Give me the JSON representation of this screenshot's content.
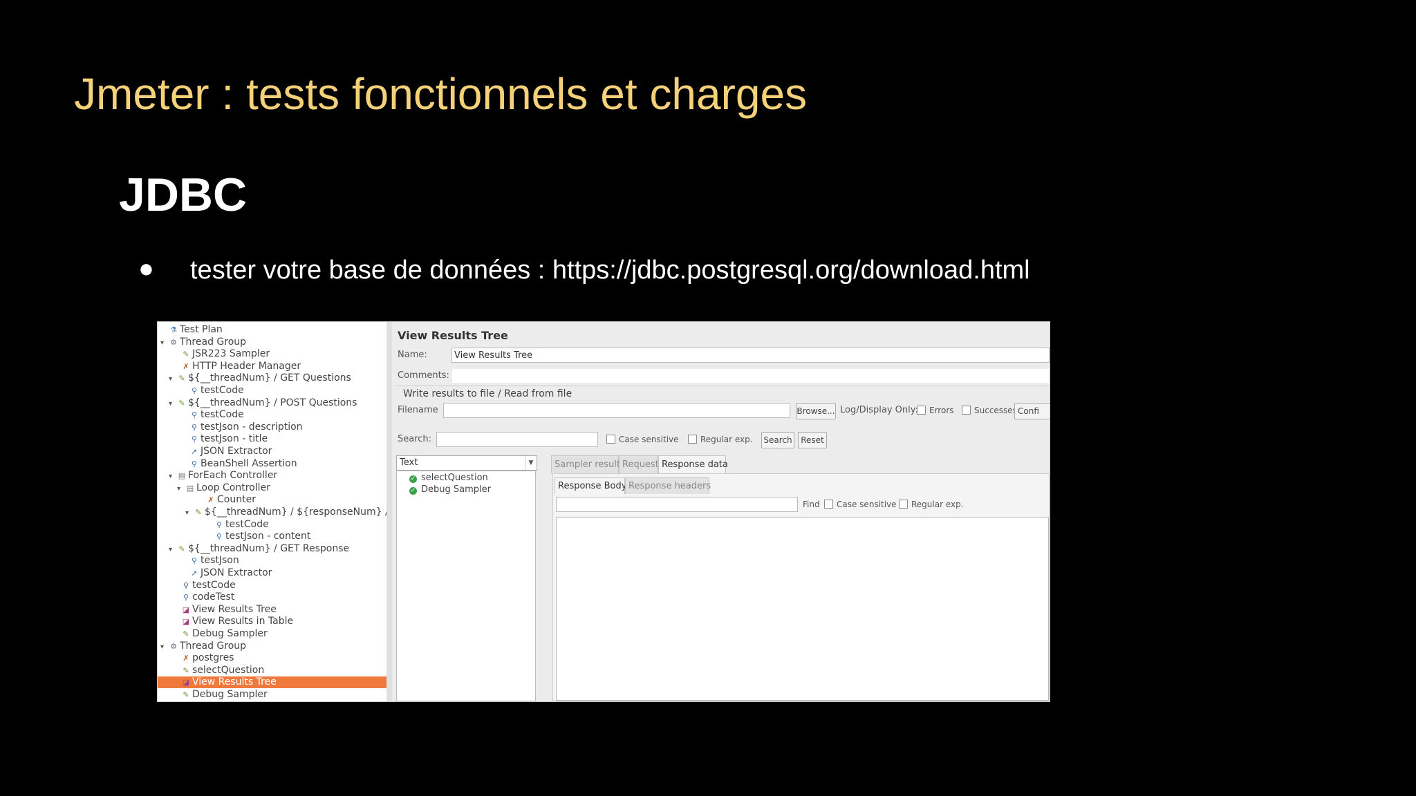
{
  "slide": {
    "title": "Jmeter : tests fonctionnels et charges",
    "subtitle": "JDBC",
    "bullet": "●",
    "bullet_text": "tester votre base de données : https://jdbc.postgresql.org/download.html"
  },
  "tree": {
    "items": [
      {
        "label": "Test Plan",
        "exp": "",
        "icon": "test-plan-icon",
        "glyph": "⚗"
      },
      {
        "label": "Thread Group",
        "exp": "▾",
        "icon": "thread-group-icon",
        "glyph": "⚙"
      },
      {
        "label": "JSR223 Sampler",
        "exp": "",
        "icon": "sampler-icon",
        "glyph": "✎"
      },
      {
        "label": "HTTP Header Manager",
        "exp": "",
        "icon": "config-icon",
        "glyph": "✗"
      },
      {
        "label": "${__threadNum} / GET Questions",
        "exp": "▾",
        "icon": "sampler-icon",
        "glyph": "✎"
      },
      {
        "label": "testCode",
        "exp": "",
        "icon": "assertion-icon",
        "glyph": "⚲"
      },
      {
        "label": "${__threadNum} / POST Questions",
        "exp": "▾",
        "icon": "sampler-icon",
        "glyph": "✎"
      },
      {
        "label": "testCode",
        "exp": "",
        "icon": "assertion-icon",
        "glyph": "⚲"
      },
      {
        "label": "testJson - description",
        "exp": "",
        "icon": "assertion-icon",
        "glyph": "⚲"
      },
      {
        "label": "testJson - title",
        "exp": "",
        "icon": "assertion-icon",
        "glyph": "⚲"
      },
      {
        "label": "JSON Extractor",
        "exp": "",
        "icon": "extractor-icon",
        "glyph": "➚"
      },
      {
        "label": "BeanShell Assertion",
        "exp": "",
        "icon": "assertion-icon",
        "glyph": "⚲"
      },
      {
        "label": "ForEach Controller",
        "exp": "▾",
        "icon": "controller-icon",
        "glyph": "▤"
      },
      {
        "label": "Loop Controller",
        "exp": "▾",
        "icon": "controller-icon",
        "glyph": "▤"
      },
      {
        "label": "Counter",
        "exp": "",
        "icon": "config-icon",
        "glyph": "✗"
      },
      {
        "label": "${__threadNum} / ${responseNum} / P",
        "exp": "▾",
        "icon": "sampler-icon",
        "glyph": "✎"
      },
      {
        "label": "testCode",
        "exp": "",
        "icon": "assertion-icon",
        "glyph": "⚲"
      },
      {
        "label": "testJson - content",
        "exp": "",
        "icon": "assertion-icon",
        "glyph": "⚲"
      },
      {
        "label": "${__threadNum} / GET Response",
        "exp": "▾",
        "icon": "sampler-icon",
        "glyph": "✎"
      },
      {
        "label": "testJson",
        "exp": "",
        "icon": "assertion-icon",
        "glyph": "⚲"
      },
      {
        "label": "JSON Extractor",
        "exp": "",
        "icon": "extractor-icon",
        "glyph": "➚"
      },
      {
        "label": "testCode",
        "exp": "",
        "icon": "assertion-icon",
        "glyph": "⚲"
      },
      {
        "label": "codeTest",
        "exp": "",
        "icon": "assertion-icon",
        "glyph": "⚲"
      },
      {
        "label": "View Results Tree",
        "exp": "",
        "icon": "listener-icon",
        "glyph": "◪"
      },
      {
        "label": "View Results in Table",
        "exp": "",
        "icon": "listener-icon",
        "glyph": "◪"
      },
      {
        "label": "Debug Sampler",
        "exp": "",
        "icon": "sampler-icon",
        "glyph": "✎"
      },
      {
        "label": "Thread Group",
        "exp": "▾",
        "icon": "thread-group-icon",
        "glyph": "⚙"
      },
      {
        "label": "postgres",
        "exp": "",
        "icon": "config-icon",
        "glyph": "✗"
      },
      {
        "label": "selectQuestion",
        "exp": "",
        "icon": "sampler-icon",
        "glyph": "✎"
      },
      {
        "label": "View Results Tree",
        "exp": "",
        "icon": "listener-icon",
        "glyph": "◪"
      },
      {
        "label": "Debug Sampler",
        "exp": "",
        "icon": "sampler-icon",
        "glyph": "✎"
      }
    ]
  },
  "panel": {
    "title": "View Results Tree",
    "name_label": "Name:",
    "name_value": "View Results Tree",
    "comments_label": "Comments:",
    "file_group_title": "Write results to file / Read from file",
    "filename_label": "Filename",
    "browse_label": "Browse...",
    "log_display_label": "Log/Display Only:",
    "errors_label": "Errors",
    "successes_label": "Successes",
    "configure_label": "Confi",
    "search_label": "Search:",
    "case_sensitive_label": "Case sensitive",
    "regular_exp_label": "Regular exp.",
    "search_button": "Search",
    "reset_button": "Reset",
    "renderer_value": "Text",
    "results": [
      "selectQuestion",
      "Debug Sampler"
    ],
    "tabs": [
      "Sampler result",
      "Request",
      "Response data"
    ],
    "subtabs": [
      "Response Body",
      "Response headers"
    ],
    "find_label": "Find",
    "find_case_label": "Case sensitive",
    "find_regex_label": "Regular exp."
  },
  "colors": {
    "title": "#f5d27a",
    "selection": "#f07a3e"
  }
}
